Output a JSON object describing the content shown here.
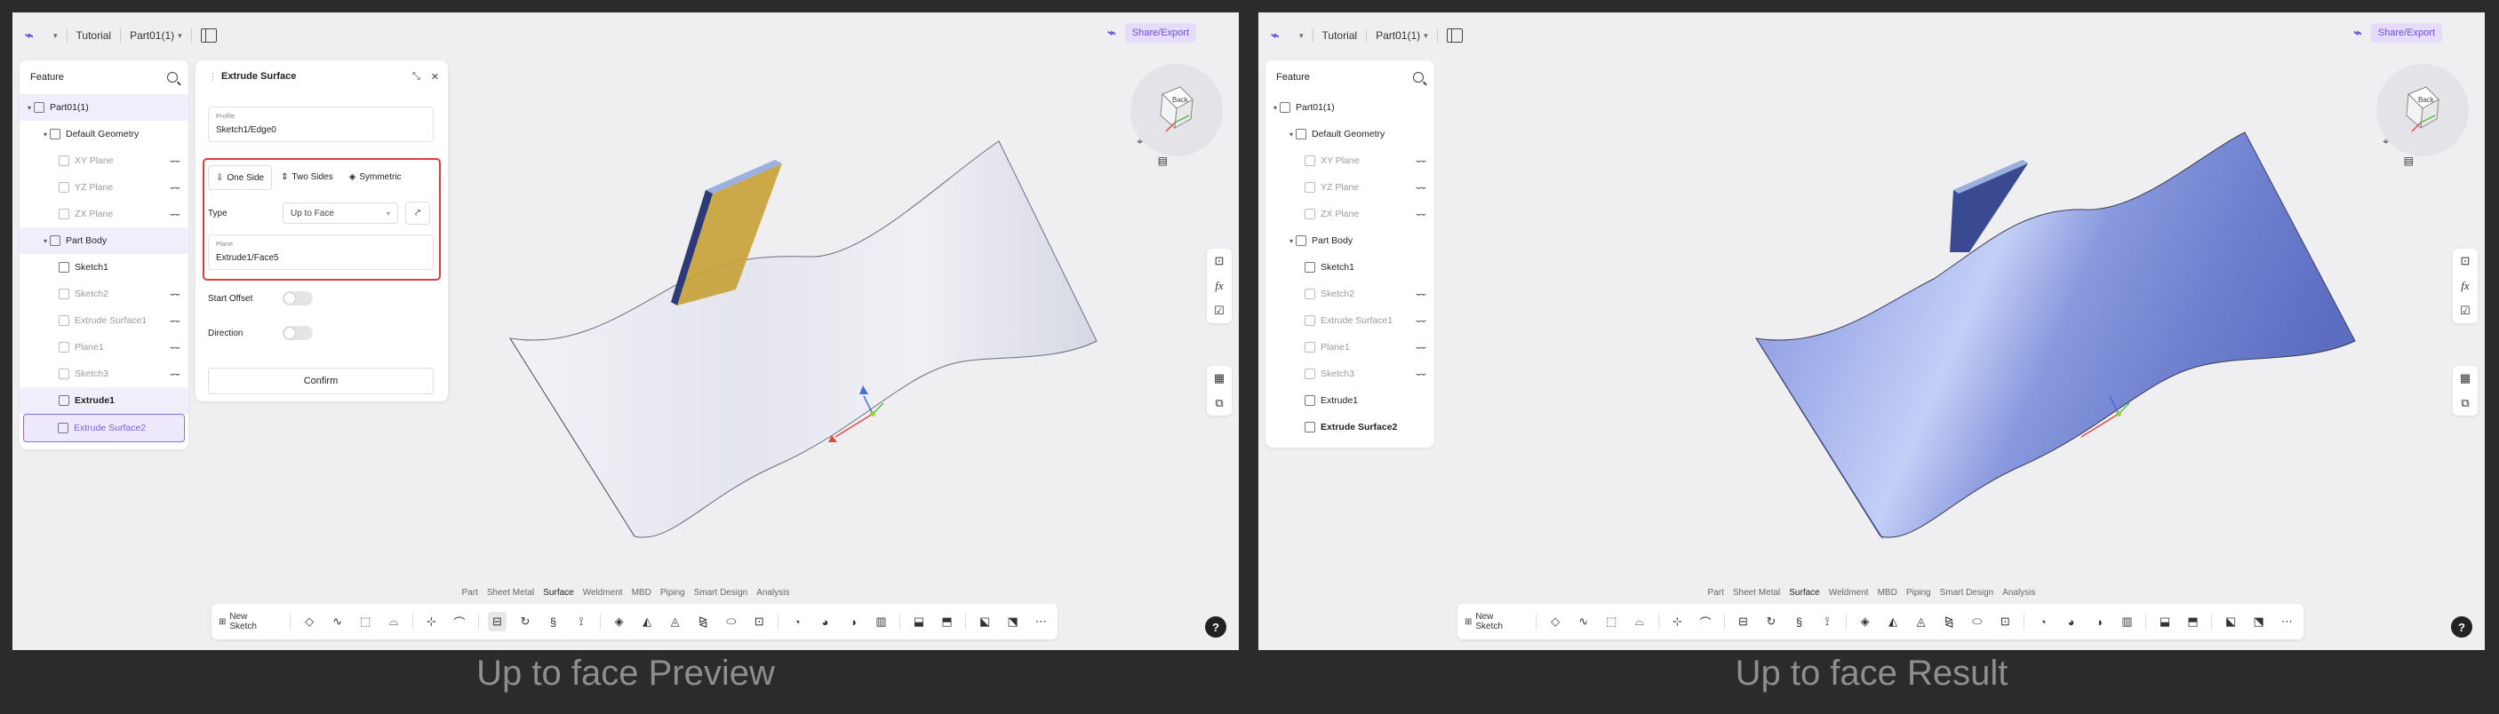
{
  "panels": [
    {
      "caption": "Up to face Preview",
      "topbar": {
        "tutorial": "Tutorial",
        "part": "Part01(1)"
      },
      "share": "Share/Export",
      "feature": {
        "title": "Feature",
        "items": [
          {
            "label": "Part01(1)"
          },
          {
            "label": "Default Geometry"
          },
          {
            "label": "XY Plane"
          },
          {
            "label": "YZ Plane"
          },
          {
            "label": "ZX Plane"
          },
          {
            "label": "Part Body"
          },
          {
            "label": "Sketch1"
          },
          {
            "label": "Sketch2"
          },
          {
            "label": "Extrude Surface1"
          },
          {
            "label": "Plane1"
          },
          {
            "label": "Sketch3"
          },
          {
            "label": "Extrude1"
          },
          {
            "label": "Extrude Surface2"
          }
        ]
      },
      "dialog": {
        "title": "Extrude Surface",
        "profile_label": "Profile",
        "profile_value": "Sketch1/Edge0",
        "seg_one": "One Side",
        "seg_two": "Two Sides",
        "seg_sym": "Symmetric",
        "type_label": "Type",
        "type_value": "Up to Face",
        "plane_label": "Plane",
        "plane_value": "Extrude1/Face5",
        "start_offset": "Start Offset",
        "direction": "Direction",
        "confirm": "Confirm"
      },
      "tabs": [
        "Part",
        "Sheet Metal",
        "Surface",
        "Weldment",
        "MBD",
        "Piping",
        "Smart Design",
        "Analysis"
      ],
      "new_sketch": "New Sketch",
      "cube_label": "Back",
      "colors": {
        "surface": "#d9dbe6",
        "block": "#c8a23a"
      }
    },
    {
      "caption": "Up to face Result",
      "topbar": {
        "tutorial": "Tutorial",
        "part": "Part01(1)"
      },
      "share": "Share/Export",
      "feature": {
        "title": "Feature",
        "items": [
          {
            "label": "Part01(1)"
          },
          {
            "label": "Default Geometry"
          },
          {
            "label": "XY Plane"
          },
          {
            "label": "YZ Plane"
          },
          {
            "label": "ZX Plane"
          },
          {
            "label": "Part Body"
          },
          {
            "label": "Sketch1"
          },
          {
            "label": "Sketch2"
          },
          {
            "label": "Extrude Surface1"
          },
          {
            "label": "Plane1"
          },
          {
            "label": "Sketch3"
          },
          {
            "label": "Extrude1"
          },
          {
            "label": "Extrude Surface2"
          }
        ]
      },
      "tabs": [
        "Part",
        "Sheet Metal",
        "Surface",
        "Weldment",
        "MBD",
        "Piping",
        "Smart Design",
        "Analysis"
      ],
      "new_sketch": "New Sketch",
      "cube_label": "Back",
      "colors": {
        "surface": "#8d9ee0",
        "block": "#3a4a90"
      }
    }
  ]
}
